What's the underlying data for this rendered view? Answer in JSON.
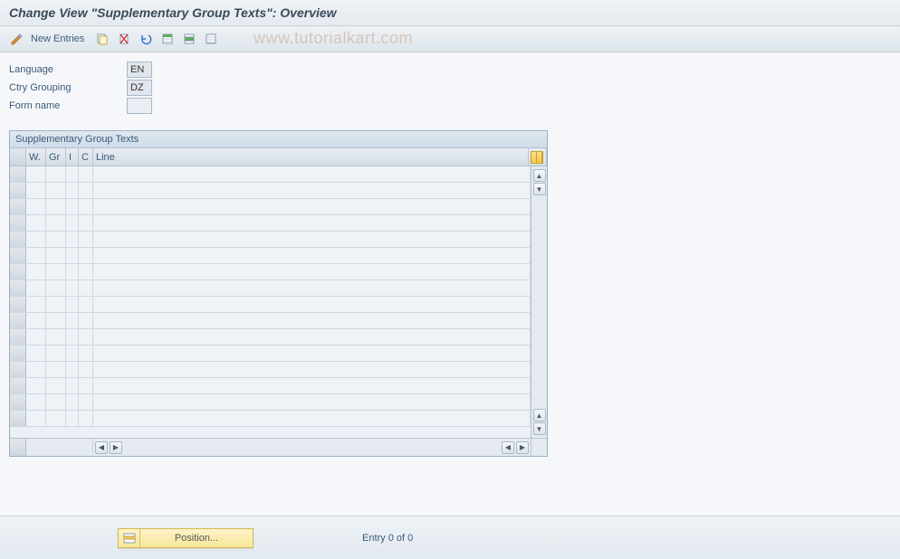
{
  "header": {
    "title": "Change View \"Supplementary Group Texts\": Overview"
  },
  "toolbar": {
    "new_entries_label": "New Entries"
  },
  "watermark": "www.tutorialkart.com",
  "form": {
    "language_label": "Language",
    "language_value": "EN",
    "ctry_label": "Ctry Grouping",
    "ctry_value": "DZ",
    "form_name_label": "Form name",
    "form_name_value": ""
  },
  "table": {
    "title": "Supplementary Group Texts",
    "columns": {
      "w": "W.",
      "gr": "Gr",
      "i": "I",
      "c": "C",
      "line": "Line"
    },
    "row_count": 16
  },
  "footer": {
    "position_label": "Position...",
    "entry_text": "Entry 0 of 0"
  }
}
